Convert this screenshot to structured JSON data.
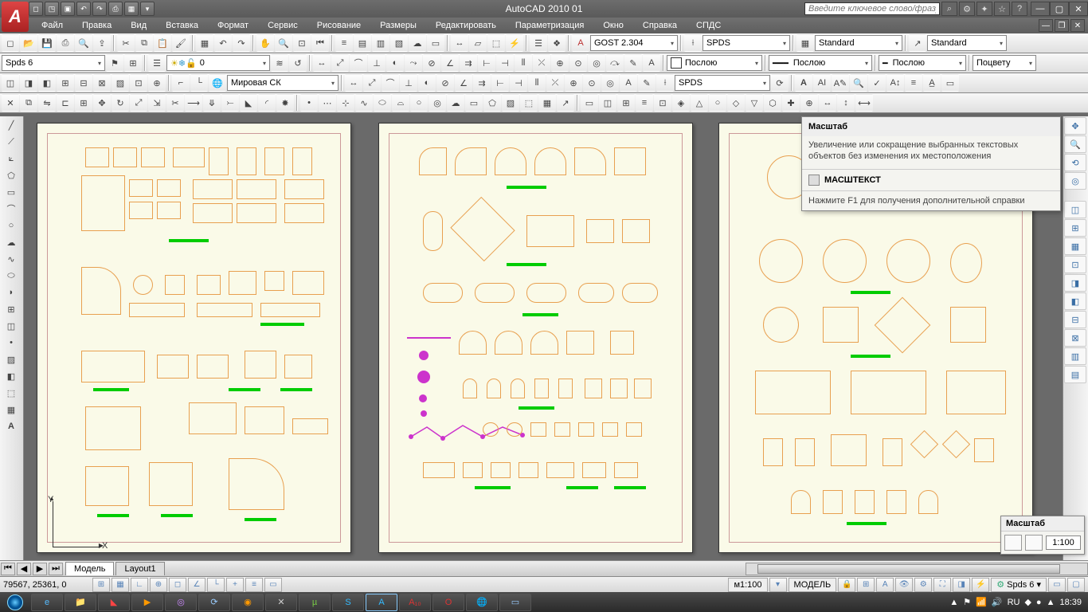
{
  "title": "AutoCAD 2010   01",
  "search_placeholder": "Введите ключевое слово/фразу",
  "logo": "A",
  "menu": [
    "Файл",
    "Правка",
    "Вид",
    "Вставка",
    "Формат",
    "Сервис",
    "Рисование",
    "Размеры",
    "Редактировать",
    "Параметризация",
    "Окно",
    "Справка",
    "СПДС"
  ],
  "toolbar_combos": {
    "text_style": "GOST 2.304",
    "dim_style": "SPDS",
    "table_style": "Standard",
    "mleader_style": "Standard",
    "layer": "Spds 6",
    "layer_num": "0",
    "coord_sys": "Мировая СК",
    "bylayer1": "Послою",
    "bylayer2": "Послою",
    "bylayer3": "Послою",
    "bycolor": "Поцвету",
    "spds": "SPDS"
  },
  "tooltip": {
    "title": "Масштаб",
    "body": "Увеличение или сокращение выбранных текстовых объектов без изменения их местоположения",
    "command": "МАСШТЕКСТ",
    "footer": "Нажмите F1 для получения дополнительной справки"
  },
  "scale_float": {
    "title": "Масштаб",
    "value": "1:100"
  },
  "tabs": {
    "model": "Модель",
    "layout1": "Layout1"
  },
  "status": {
    "coords": "79567, 25361, 0",
    "scale": "м1:100",
    "model_btn": "МОДЕЛЬ",
    "spds": "Spds 6"
  },
  "ucs": {
    "x": "X",
    "y": "Y"
  },
  "taskbar": {
    "lang": "RU",
    "time": "18:39"
  }
}
